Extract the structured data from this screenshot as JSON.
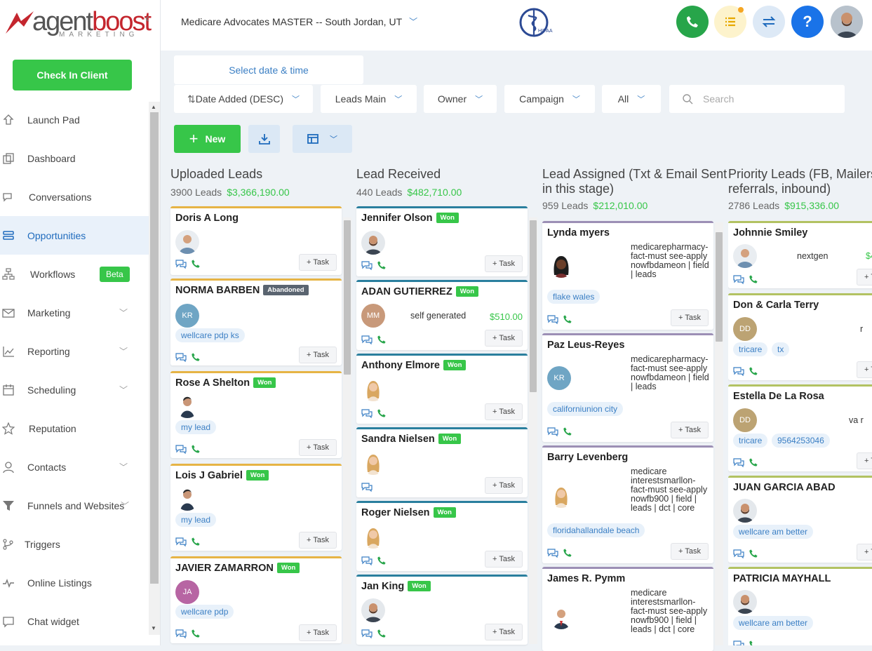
{
  "app": {
    "brand_a": "agent",
    "brand_b": "boost",
    "brand_sub": "MARKETING"
  },
  "sidebar": {
    "check_in": "Check In Client",
    "items": [
      {
        "label": "Launch Pad",
        "icon": "rocket-icon"
      },
      {
        "label": "Dashboard",
        "icon": "dashboard-icon"
      },
      {
        "label": "Conversations",
        "icon": "chat-icon"
      },
      {
        "label": "Opportunities",
        "icon": "layers-icon",
        "active": true
      },
      {
        "label": "Workflows",
        "icon": "workflow-icon",
        "badge": "Beta"
      },
      {
        "label": "Marketing",
        "icon": "mail-icon",
        "expandable": true
      },
      {
        "label": "Reporting",
        "icon": "chart-icon",
        "expandable": true
      },
      {
        "label": "Scheduling",
        "icon": "calendar-icon",
        "expandable": true
      },
      {
        "label": "Reputation",
        "icon": "star-icon"
      },
      {
        "label": "Contacts",
        "icon": "user-icon",
        "expandable": true
      },
      {
        "label": "Funnels and Websites",
        "icon": "filter-icon",
        "expandable": true
      },
      {
        "label": "Triggers",
        "icon": "trigger-icon"
      },
      {
        "label": "Online Listings",
        "icon": "pulse-icon"
      },
      {
        "label": "Chat widget",
        "icon": "chat-widget-icon"
      }
    ]
  },
  "topbar": {
    "account": "Medicare Advocates MASTER -- South Jordan, UT",
    "hipaa_label": "HIPAA"
  },
  "toolbar": {
    "date_picker": "Select date & time",
    "sort": "Date Added (DESC)",
    "pipeline": "Leads Main",
    "owner": "Owner",
    "campaign": "Campaign",
    "status": "All",
    "search_placeholder": "Search",
    "new_label": "New"
  },
  "colors": {
    "green": "#37c649",
    "blue": "#1f6bbd",
    "col1": "#e6b445",
    "col2": "#2a7f9e",
    "col3": "#9c8fb5",
    "col4": "#b2c262"
  },
  "columns": [
    {
      "title": "Uploaded Leads",
      "count": "3900 Leads",
      "amount": "$3,366,190.00",
      "cards": [
        {
          "name": "Doris A Long"
        },
        {
          "name": "NORMA BARBEN",
          "status": "Abandoned",
          "initials": "KR",
          "tag1": "wellcare pdp ks"
        },
        {
          "name": "Rose A Shelton",
          "status": "Won",
          "tag1": "my lead"
        },
        {
          "name": "Lois J Gabriel",
          "status": "Won",
          "tag1": "my lead"
        },
        {
          "name": "JAVIER ZAMARRON",
          "status": "Won",
          "initials": "JA",
          "tag1": "wellcare pdp"
        }
      ]
    },
    {
      "title": "Lead Received",
      "count": "440 Leads",
      "amount": "$482,710.00",
      "cards": [
        {
          "name": "Jennifer Olson",
          "status": "Won"
        },
        {
          "name": "ADAN GUTIERREZ",
          "status": "Won",
          "initials": "MM",
          "source": "self generated",
          "value": "$510.00"
        },
        {
          "name": "Anthony Elmore",
          "status": "Won"
        },
        {
          "name": "Sandra Nielsen",
          "status": "Won"
        },
        {
          "name": "Roger Nielsen",
          "status": "Won"
        },
        {
          "name": "Jan King",
          "status": "Won"
        }
      ]
    },
    {
      "title_1": "Lead Assigned (Txt & Email Sent",
      "title_2": "in this stage)",
      "count": "959 Leads",
      "amount": "$212,010.00",
      "cards": [
        {
          "name": "Lynda myers",
          "source": "medicarepharmacy-fact-must see-apply nowfbdameon | field | leads",
          "tag1": "flake wales"
        },
        {
          "name": "Paz Leus-Reyes",
          "initials": "KR",
          "source": "medicarepharmacy-fact-must see-apply nowfbdameon | field | leads",
          "tag1": "californiunion city"
        },
        {
          "name": "Barry Levenberg",
          "source": "medicare interestsmarllon-fact-must see-apply nowfb900 | field | leads | dct | core",
          "tag1": "floridahallandale beach"
        },
        {
          "name": "James R. Pymm",
          "source": "medicare interestsmarllon-fact-must see-apply nowfb900 | field | leads | dct | core"
        }
      ]
    },
    {
      "title_1": "Priority Leads (FB, Mailers,",
      "title_2": "referrals, inbound)",
      "count": "2786 Leads",
      "amount": "$915,336.00",
      "cards": [
        {
          "name": "Johnnie Smiley",
          "source": "nextgen",
          "value": "$4"
        },
        {
          "name": "Don & Carla Terry",
          "initials": "DD",
          "source": "r",
          "tag1": "tricare",
          "tag2": "tx"
        },
        {
          "name": "Estella De La Rosa",
          "initials": "DD",
          "source": "va r",
          "tag1": "tricare",
          "tag2": "9564253046"
        },
        {
          "name": "JUAN GARCIA ABAD",
          "tag1": "wellcare am better"
        },
        {
          "name": "PATRICIA MAYHALL",
          "tag1": "wellcare am better"
        }
      ]
    }
  ],
  "task_label": "+ Task"
}
